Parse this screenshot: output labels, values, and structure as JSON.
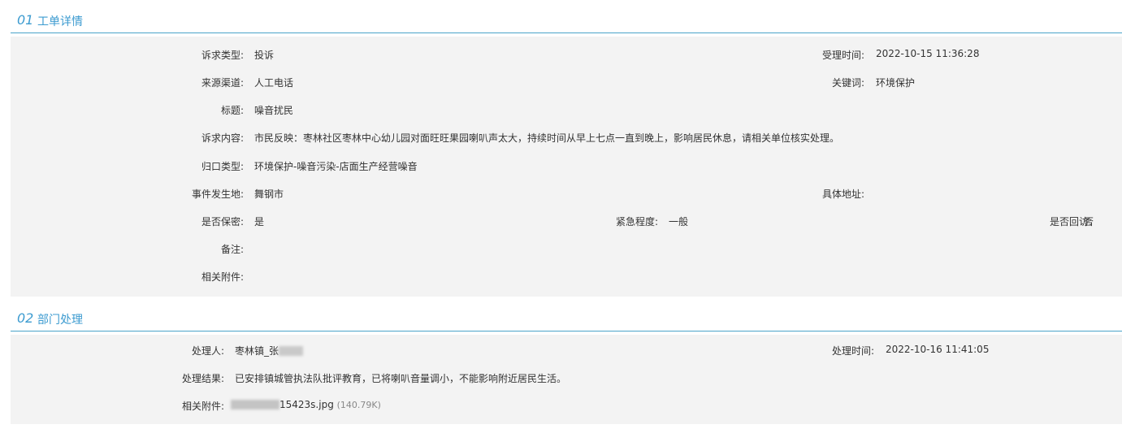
{
  "section1": {
    "number": "01",
    "title": "工单详情",
    "rows": {
      "appeal_type": {
        "label": "诉求类型:",
        "value": "投诉"
      },
      "accept_time": {
        "label": "受理时间:",
        "value": "2022-10-15 11:36:28"
      },
      "source_channel": {
        "label": "来源渠道:",
        "value": "人工电话"
      },
      "keyword": {
        "label": "关键词:",
        "value": "环境保护"
      },
      "title": {
        "label": "标题:",
        "value": "噪音扰民"
      },
      "content": {
        "label": "诉求内容:",
        "value": "市民反映：枣林社区枣林中心幼儿园对面旺旺果园喇叭声太大，持续时间从早上七点一直到晚上，影响居民休息，请相关单位核实处理。"
      },
      "category": {
        "label": "归口类型:",
        "value": "环境保护-噪音污染-店面生产经营噪音"
      },
      "location": {
        "label": "事件发生地:",
        "value": "舞钢市"
      },
      "address": {
        "label": "具体地址:",
        "value": ""
      },
      "confidential": {
        "label": "是否保密:",
        "value": "是"
      },
      "urgency": {
        "label": "紧急程度:",
        "value": "一般"
      },
      "revisit": {
        "label": "是否回访:",
        "value": "否"
      },
      "remarks": {
        "label": "备注:",
        "value": ""
      },
      "attachments": {
        "label": "相关附件:",
        "value": ""
      }
    }
  },
  "section2": {
    "number": "02",
    "title": "部门处理",
    "rows": {
      "handler": {
        "label": "处理人:",
        "value": "枣林镇_张"
      },
      "handle_time": {
        "label": "处理时间:",
        "value": "2022-10-16 11:41:05"
      },
      "result": {
        "label": "处理结果:",
        "value": "已安排镇城管执法队批评教育，已将喇叭音量调小，不能影响附近居民生活。"
      },
      "attachments": {
        "label": "相关附件:",
        "file_name": "15423s.jpg",
        "file_size": "(140.79K)"
      }
    }
  },
  "colors": {
    "accent": "#3c9bd0",
    "panel_bg": "#f3f3f3",
    "divider": "#4aa3c8"
  }
}
